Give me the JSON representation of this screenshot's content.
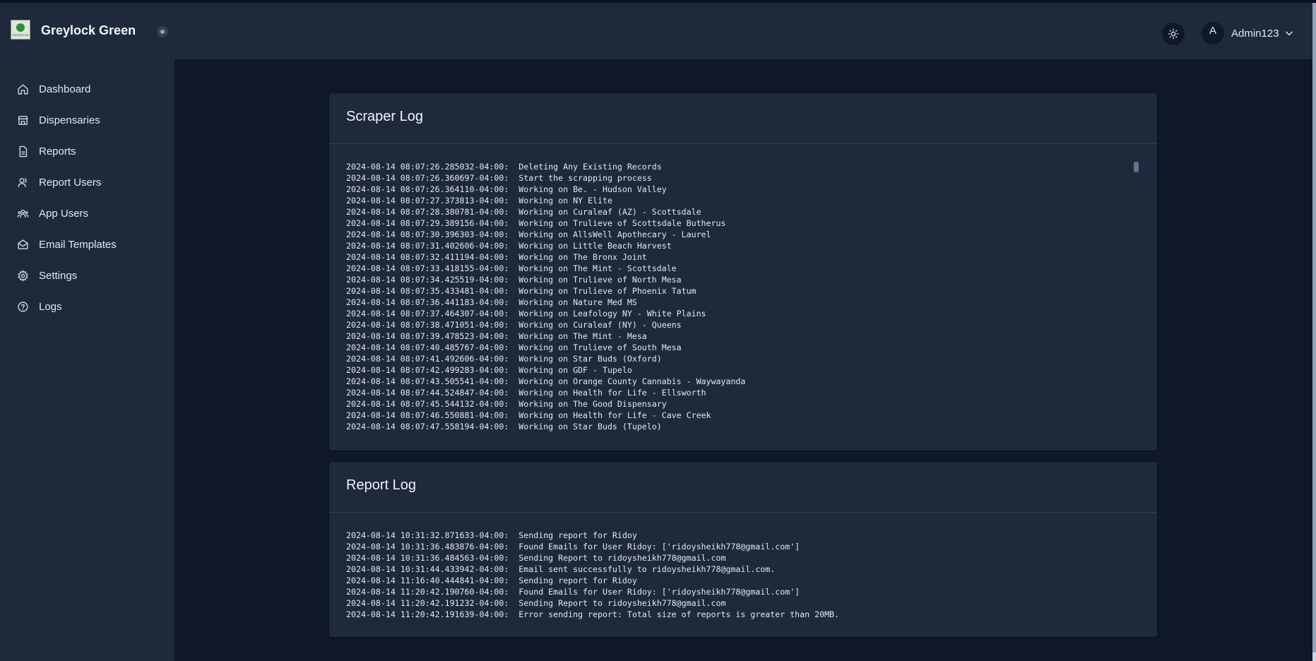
{
  "header": {
    "brand": "Greylock Green",
    "logo_text": "Greylock",
    "avatar_initial": "A",
    "username": "Admin123"
  },
  "sidebar": {
    "items": [
      {
        "label": "Dashboard",
        "icon": "home-icon"
      },
      {
        "label": "Dispensaries",
        "icon": "store-icon"
      },
      {
        "label": "Reports",
        "icon": "document-icon"
      },
      {
        "label": "Report Users",
        "icon": "user-group-icon"
      },
      {
        "label": "App Users",
        "icon": "users-icon"
      },
      {
        "label": "Email Templates",
        "icon": "envelope-icon"
      },
      {
        "label": "Settings",
        "icon": "gear-icon"
      },
      {
        "label": "Logs",
        "icon": "help-circle-icon"
      }
    ]
  },
  "scraper_log": {
    "title": "Scraper Log",
    "lines": [
      "2024-08-14 08:07:26.285032-04:00:  Deleting Any Existing Records",
      "2024-08-14 08:07:26.360697-04:00:  Start the scrapping process",
      "2024-08-14 08:07:26.364110-04:00:  Working on Be. - Hudson Valley",
      "2024-08-14 08:07:27.373813-04:00:  Working on NY Elite",
      "2024-08-14 08:07:28.380781-04:00:  Working on Curaleaf (AZ) - Scottsdale",
      "2024-08-14 08:07:29.389156-04:00:  Working on Trulieve of Scottsdale Butherus",
      "2024-08-14 08:07:30.396303-04:00:  Working on AllsWell Apothecary - Laurel",
      "2024-08-14 08:07:31.402606-04:00:  Working on Little Beach Harvest",
      "2024-08-14 08:07:32.411194-04:00:  Working on The Bronx Joint",
      "2024-08-14 08:07:33.418155-04:00:  Working on The Mint - Scottsdale",
      "2024-08-14 08:07:34.425519-04:00:  Working on Trulieve of North Mesa",
      "2024-08-14 08:07:35.433481-04:00:  Working on Trulieve of Phoenix Tatum",
      "2024-08-14 08:07:36.441183-04:00:  Working on Nature Med MS",
      "2024-08-14 08:07:37.464307-04:00:  Working on Leafology NY - White Plains",
      "2024-08-14 08:07:38.471051-04:00:  Working on Curaleaf (NY) - Queens",
      "2024-08-14 08:07:39.478523-04:00:  Working on The Mint - Mesa",
      "2024-08-14 08:07:40.485767-04:00:  Working on Trulieve of South Mesa",
      "2024-08-14 08:07:41.492606-04:00:  Working on Star Buds (Oxford)",
      "2024-08-14 08:07:42.499283-04:00:  Working on GDF - Tupelo",
      "2024-08-14 08:07:43.505541-04:00:  Working on Orange County Cannabis - Waywayanda",
      "2024-08-14 08:07:44.524847-04:00:  Working on Health for Life - Ellsworth",
      "2024-08-14 08:07:45.544132-04:00:  Working on The Good Dispensary",
      "2024-08-14 08:07:46.550881-04:00:  Working on Health for Life - Cave Creek",
      "2024-08-14 08:07:47.558194-04:00:  Working on Star Buds (Tupelo)"
    ]
  },
  "report_log": {
    "title": "Report Log",
    "lines": [
      "2024-08-14 10:31:32.871633-04:00:  Sending report for Ridoy",
      "2024-08-14 10:31:36.483876-04:00:  Found Emails for User Ridoy: ['ridoysheikh778@gmail.com']",
      "2024-08-14 10:31:36.484563-04:00:  Sending Report to ridoysheikh778@gmail.com",
      "2024-08-14 10:31:44.433942-04:00:  Email sent successfully to ridoysheikh778@gmail.com.",
      "2024-08-14 11:16:40.444841-04:00:  Sending report for Ridoy",
      "2024-08-14 11:20:42.190760-04:00:  Found Emails for User Ridoy: ['ridoysheikh778@gmail.com']",
      "2024-08-14 11:20:42.191232-04:00:  Sending Report to ridoysheikh778@gmail.com",
      "2024-08-14 11:20:42.191639-04:00:  Error sending report: Total size of reports is greater than 20MB."
    ]
  }
}
